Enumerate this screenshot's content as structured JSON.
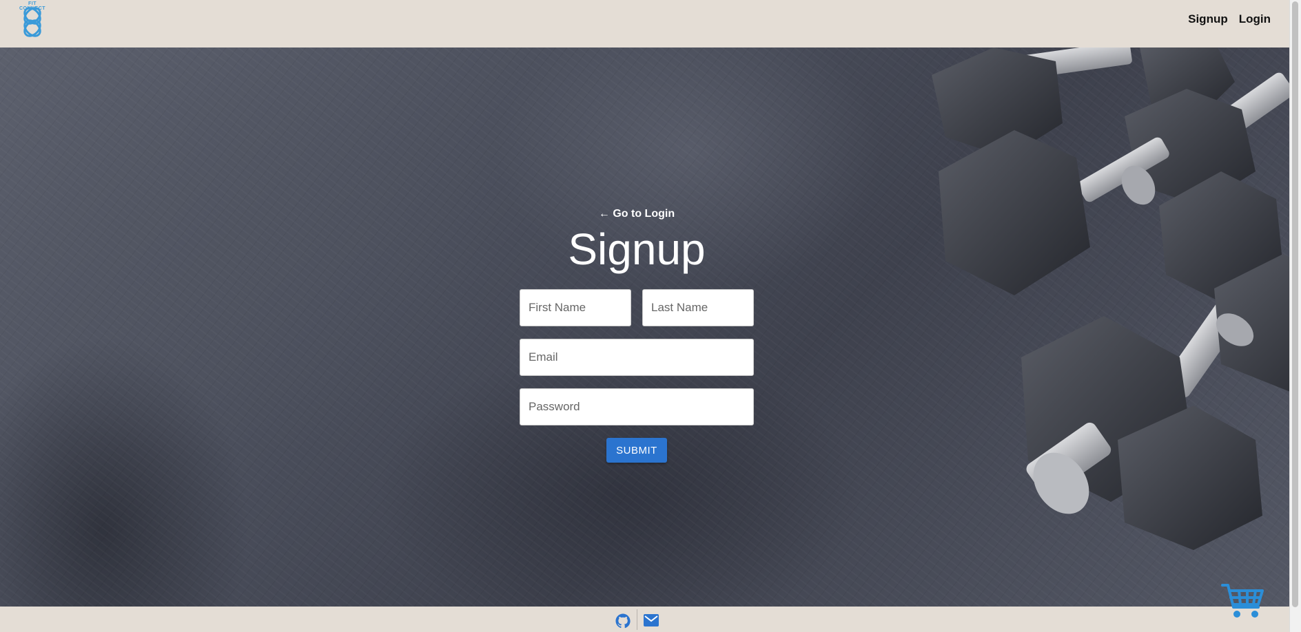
{
  "header": {
    "logo_text": "FIT CONNECT",
    "nav": [
      {
        "label": "Signup"
      },
      {
        "label": "Login"
      }
    ]
  },
  "form": {
    "back_link": "← Go to Login",
    "title": "Signup",
    "first_name_placeholder": "First Name",
    "last_name_placeholder": "Last Name",
    "email_placeholder": "Email",
    "password_placeholder": "Password",
    "submit_label": "SUBMIT"
  },
  "footer": {
    "icons": [
      "github-icon",
      "mail-icon"
    ]
  },
  "floating": {
    "icon": "shopping-cart-icon"
  },
  "colors": {
    "header_bg": "#e4ddd5",
    "accent": "#2b74cf",
    "logo": "#3a9ad9"
  }
}
